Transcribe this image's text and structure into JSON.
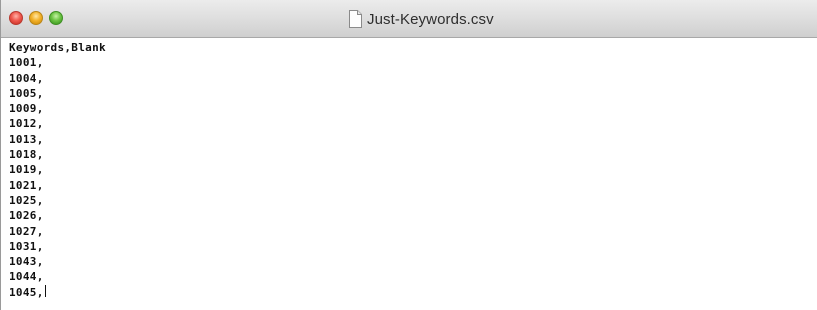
{
  "window": {
    "title": "Just-Keywords.csv",
    "icon": "document-icon"
  },
  "editor": {
    "lines": [
      "Keywords,Blank",
      "1001,",
      "1004,",
      "1005,",
      "1009,",
      "1012,",
      "1013,",
      "1018,",
      "1019,",
      "1021,",
      "1025,",
      "1026,",
      "1027,",
      "1031,",
      "1043,",
      "1044,",
      "1045,"
    ]
  }
}
